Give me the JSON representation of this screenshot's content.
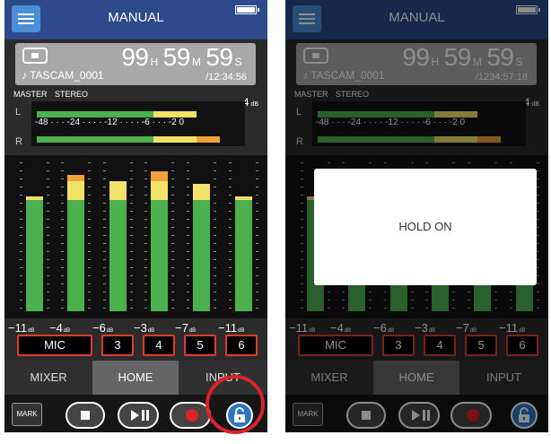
{
  "screens": [
    {
      "title": "MANUAL",
      "counter": {
        "hours": "99",
        "h": "H",
        "minutes": "59",
        "m": "M",
        "seconds": "59",
        "s": "S"
      },
      "file_name": "♪ TASCAM_0001",
      "total_time": "/12:34:56",
      "master_label": "MASTER",
      "stereo_label": "STEREO",
      "meter_L": "L",
      "meter_R": "R",
      "meter_peak": "−4",
      "meter_peak_unit": "dB",
      "meter_scale": "-48 · · · -24 · · · · -12 · · · · -6 · · · -2 0",
      "channel_peaks": [
        {
          "value": "−11",
          "unit": "dB"
        },
        {
          "value": "−4",
          "unit": "dB"
        },
        {
          "value": "−6",
          "unit": "dB"
        },
        {
          "value": "−3",
          "unit": "dB"
        },
        {
          "value": "−7",
          "unit": "dB"
        },
        {
          "value": "−11",
          "unit": "dB"
        }
      ],
      "channel_labels": [
        "MIC",
        "3",
        "4",
        "5",
        "6"
      ],
      "tabs": [
        "MIXER",
        "HOME",
        "INPUT"
      ],
      "mark_label": "MARK"
    },
    {
      "title": "MANUAL",
      "counter": {
        "hours": "99",
        "h": "H",
        "minutes": "59",
        "m": "M",
        "seconds": "59",
        "s": "S"
      },
      "file_name": "♪ TASCAM_0001",
      "total_time": "/1234:57:18",
      "master_label": "MASTER",
      "stereo_label": "STEREO",
      "meter_L": "L",
      "meter_R": "R",
      "meter_peak": "−4",
      "meter_peak_unit": "dB",
      "meter_scale": "-48 · · · -24 · · · · -12 · · · · -6 · · · -2 0",
      "channel_peaks": [
        {
          "value": "−11",
          "unit": "dB"
        },
        {
          "value": "−4",
          "unit": "dB"
        },
        {
          "value": "−6",
          "unit": "dB"
        },
        {
          "value": "−3",
          "unit": "dB"
        },
        {
          "value": "−7",
          "unit": "dB"
        },
        {
          "value": "−11",
          "unit": "dB"
        }
      ],
      "channel_labels": [
        "MIC",
        "3",
        "4",
        "5",
        "6"
      ],
      "tabs": [
        "MIXER",
        "HOME",
        "INPUT"
      ],
      "mark_label": "MARK",
      "popup_text": "HOLD ON"
    }
  ],
  "channel_levels_db": [
    -11,
    -4,
    -6,
    -3,
    -7,
    -11
  ],
  "colors": {
    "title_bar": "#2c4a8c",
    "meter_green": "#4cb04f",
    "meter_yellow": "#f2e26a",
    "meter_orange": "#f0a13a",
    "record_red": "#e0202a",
    "lock_blue": "#2b77c7",
    "highlight_ring": "#d8232a"
  },
  "icons": {
    "menu": "hamburger-menu-icon",
    "stop": "stop-icon",
    "play_pause": "play-pause-icon",
    "record": "record-icon",
    "lock": "padlock-icon",
    "battery": "battery-icon"
  }
}
